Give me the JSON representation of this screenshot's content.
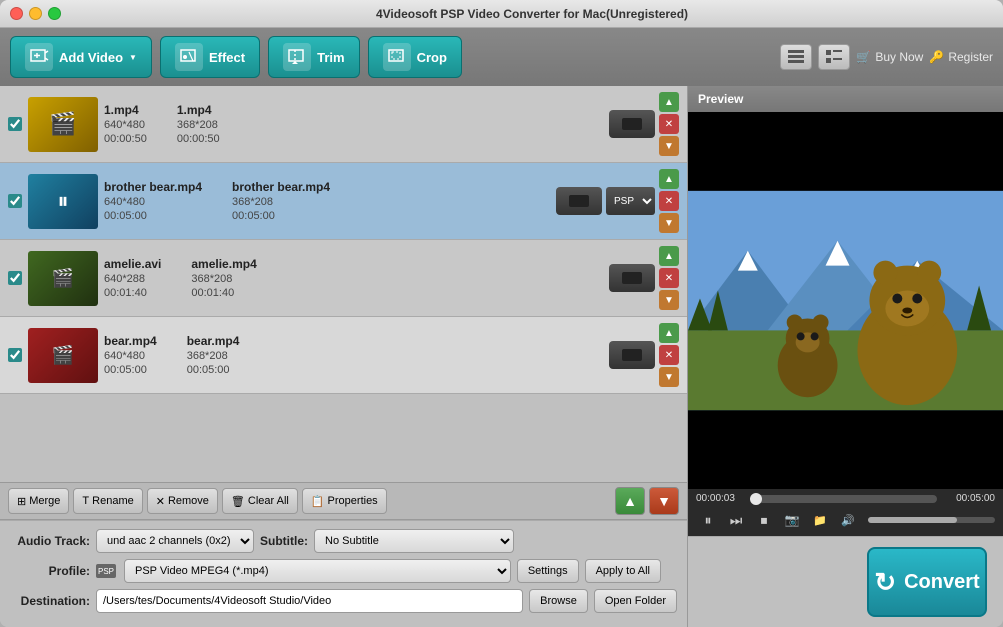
{
  "window": {
    "title": "4Videosoft PSP Video Converter for Mac(Unregistered)"
  },
  "toolbar": {
    "add_video": "Add Video",
    "effect": "Effect",
    "trim": "Trim",
    "crop": "Crop",
    "buy_now": "Buy Now",
    "register": "Register"
  },
  "files": [
    {
      "id": 1,
      "name_src": "1.mp4",
      "size_src": "640*480",
      "duration_src": "00:00:50",
      "name_out": "1.mp4",
      "size_out": "368*208",
      "duration_out": "00:00:50",
      "checked": true,
      "active": false
    },
    {
      "id": 2,
      "name_src": "brother bear.mp4",
      "size_src": "640*480",
      "duration_src": "00:05:00",
      "name_out": "brother bear.mp4",
      "size_out": "368*208",
      "duration_out": "00:05:00",
      "checked": true,
      "active": true
    },
    {
      "id": 3,
      "name_src": "amelie.avi",
      "size_src": "640*288",
      "duration_src": "00:01:40",
      "name_out": "amelie.mp4",
      "size_out": "368*208",
      "duration_out": "00:01:40",
      "checked": true,
      "active": false
    },
    {
      "id": 4,
      "name_src": "bear.mp4",
      "size_src": "640*480",
      "duration_src": "00:05:00",
      "name_out": "bear.mp4",
      "size_out": "368*208",
      "duration_out": "00:05:00",
      "checked": true,
      "active": false
    }
  ],
  "actions": {
    "merge": "Merge",
    "rename": "Rename",
    "remove": "Remove",
    "clear_all": "Clear All",
    "properties": "Properties"
  },
  "bottom": {
    "audio_track_label": "Audio Track:",
    "audio_track_value": "und aac 2 channels (0x2)",
    "subtitle_label": "Subtitle:",
    "subtitle_value": "No Subtitle",
    "profile_label": "Profile:",
    "profile_value": "PSP Video MPEG4 (*.mp4)",
    "destination_label": "Destination:",
    "destination_value": "/Users/tes/Documents/4Videosoft Studio/Video",
    "settings": "Settings",
    "apply_to_all": "Apply to All",
    "browse": "Browse",
    "open_folder": "Open Folder",
    "convert": "Convert"
  },
  "preview": {
    "label": "Preview",
    "time_current": "00:00:03",
    "time_total": "00:05:00",
    "progress_pct": 1,
    "volume_pct": 70
  }
}
